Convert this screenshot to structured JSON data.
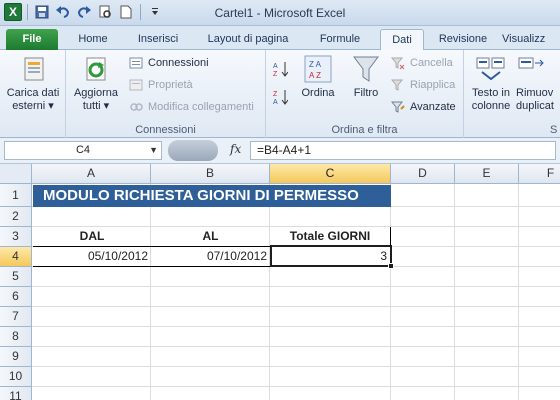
{
  "titlebar": {
    "window_title": "Cartel1  -  Microsoft Excel",
    "app_logo": "X",
    "icons": [
      "excel-logo",
      "save-icon",
      "undo-icon",
      "redo-icon",
      "print-preview-icon",
      "new-document-icon",
      "customize-qat-icon"
    ]
  },
  "tabs": [
    "File",
    "Home",
    "Inserisci",
    "Layout di pagina",
    "Formule",
    "Dati",
    "Revisione",
    "Visualizz"
  ],
  "active_tab": "Dati",
  "ribbon": {
    "external_data": {
      "line1": "Carica dati",
      "line2": "esterni"
    },
    "refresh": {
      "line1": "Aggiorna",
      "line2": "tutti"
    },
    "connections": "Connessioni",
    "properties": "Proprietà",
    "edit_links": "Modifica collegamenti",
    "connections_group": "Connessioni",
    "sort": "Ordina",
    "filter": "Filtro",
    "clear": "Cancella",
    "reapply": "Riapplica",
    "advanced": "Avanzate",
    "sort_filter_group": "Ordina e filtra",
    "text_to_columns": {
      "line1": "Testo in",
      "line2": "colonne"
    },
    "remove_duplicates": {
      "line1": "Rimuov",
      "line2": "duplicat"
    },
    "data_tools_group": "S"
  },
  "formula_bar": {
    "name_box": "C4",
    "fx": "fx",
    "formula": "=B4-A4+1"
  },
  "grid": {
    "columns": [
      "A",
      "B",
      "C",
      "D",
      "E",
      "F"
    ],
    "rows": [
      "1",
      "2",
      "3",
      "4",
      "5",
      "6",
      "7",
      "8",
      "9",
      "10",
      "11"
    ],
    "selected_column": "C",
    "selected_row": "4"
  },
  "sheet": {
    "title": "MODULO RICHIESTA GIORNI DI PERMESSO",
    "header_dal": "DAL",
    "header_al": "AL",
    "header_totale": "Totale GIORNI",
    "dal_value": "05/10/2012",
    "al_value": "07/10/2012",
    "totale_value": "3"
  },
  "colors": {
    "title_fill": "#2f5f98",
    "file_tab": "#1d7a30",
    "selection_header": "#f5c85c"
  }
}
